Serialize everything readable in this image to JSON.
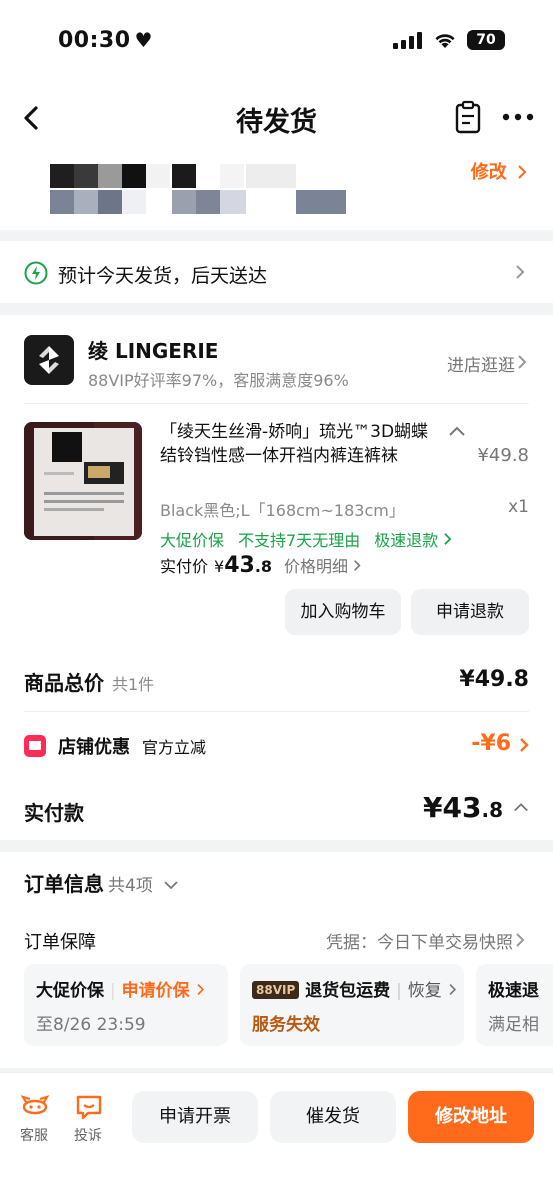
{
  "status_bar": {
    "time": "00:30",
    "battery": "70"
  },
  "nav": {
    "title": "待发货"
  },
  "address": {
    "edit_label": "修改"
  },
  "delivery": {
    "text": "预计今天发货，后天送达"
  },
  "shop": {
    "name": "绫 LINGERIE",
    "rating": "88VIP好评率97%，客服满意度96%",
    "enter_label": "进店逛逛"
  },
  "product": {
    "title": "「绫天生丝滑-娇响」琉光™3D蝴蝶结铃铛性感一体开裆内裤连裤袜",
    "price": "¥49.8",
    "spec": "Black黑色;L「168cm~183cm」",
    "qty": "x1",
    "guarantees": [
      "大促价保",
      "不支持7天无理由",
      "极速退款"
    ],
    "paid_label": "实付价",
    "paid_yen": "¥",
    "paid_int": "43",
    "paid_dec": ".8",
    "price_detail": "价格明细",
    "add_cart": "加入购物车",
    "refund": "申请退款"
  },
  "summary": {
    "total_label": "商品总价",
    "total_count": "共1件",
    "total_value": "¥49.8",
    "coupon_label": "店铺优惠",
    "coupon_sub": "官方立减",
    "coupon_value": "-¥6",
    "paid_label": "实付款",
    "paid_int": "¥43",
    "paid_dec": ".8"
  },
  "order_info": {
    "title": "订单信息",
    "count": "共4项",
    "guarantee_label": "订单保障",
    "proof": "凭据：今日下单交易快照",
    "cards": [
      {
        "title": "大促价保",
        "action": "申请价保",
        "sub": "至8/26 23:59"
      },
      {
        "badge": "88VIP",
        "title": "退货包运费",
        "action": "恢复",
        "sub": "服务失效"
      },
      {
        "title": "极速退",
        "sub": "满足相"
      }
    ]
  },
  "bottom_bar": {
    "service": "客服",
    "complain": "投诉",
    "invoice": "申请开票",
    "urge": "催发货",
    "modify_address": "修改地址"
  },
  "colors": {
    "accent": "#ff6b1a",
    "green": "#1aa34a",
    "coupon": "#ff2d55"
  }
}
